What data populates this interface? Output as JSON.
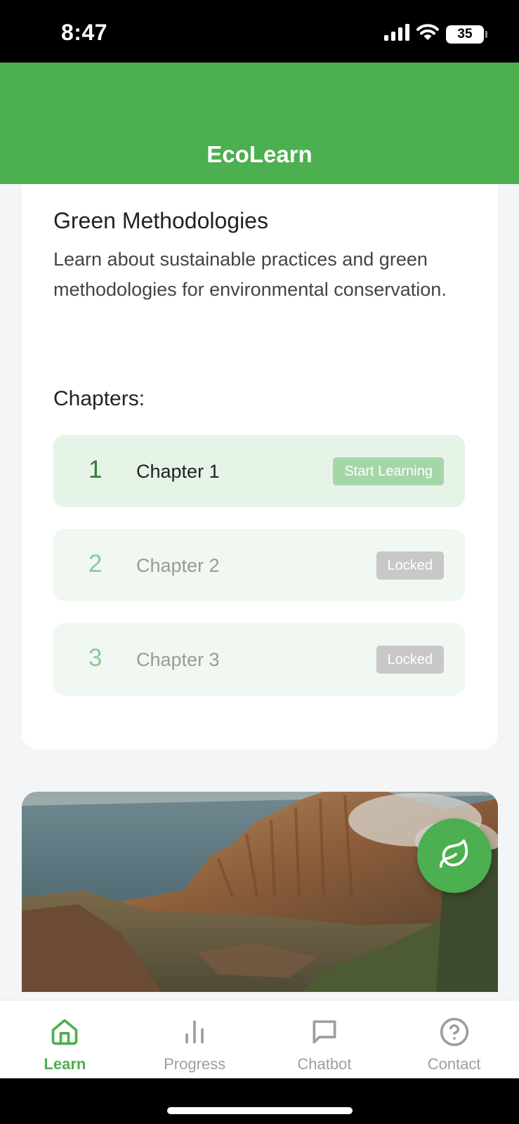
{
  "status_bar": {
    "time": "8:47",
    "battery": "35"
  },
  "header": {
    "title": "EcoLearn"
  },
  "course": {
    "title": "Green Methodologies",
    "description": "Learn about sustainable practices and green methodologies for environmental conservation.",
    "chapters_heading": "Chapters:",
    "chapters": [
      {
        "number": "1",
        "name": "Chapter 1",
        "action": "Start Learning",
        "state": "available"
      },
      {
        "number": "2",
        "name": "Chapter 2",
        "action": "Locked",
        "state": "locked"
      },
      {
        "number": "3",
        "name": "Chapter 3",
        "action": "Locked",
        "state": "locked"
      }
    ]
  },
  "fab": {
    "icon": "leaf-icon"
  },
  "nav": {
    "items": [
      {
        "label": "Learn",
        "icon": "home-icon",
        "active": true
      },
      {
        "label": "Progress",
        "icon": "bar-chart-icon",
        "active": false
      },
      {
        "label": "Chatbot",
        "icon": "chat-bubble-icon",
        "active": false
      },
      {
        "label": "Contact",
        "icon": "help-circle-icon",
        "active": false
      }
    ]
  },
  "colors": {
    "primary": "#4caf50",
    "primary_dark": "#2e7d32",
    "chapter_active_bg": "#e5f4e6",
    "chapter_locked_bg": "#f0f8f1",
    "start_button": "#a5d6a7",
    "locked_button": "#c8c8c8"
  }
}
